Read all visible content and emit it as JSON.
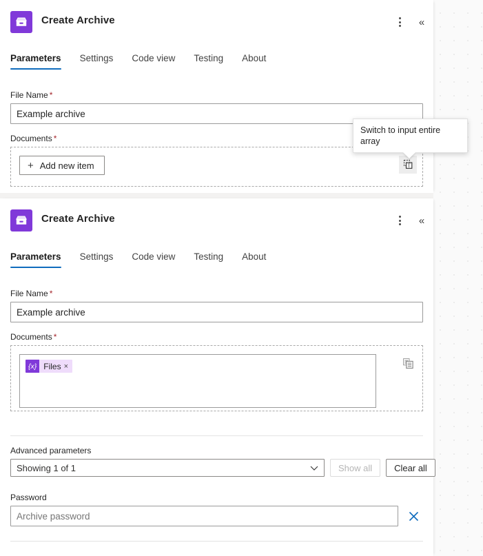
{
  "canvas": {
    "background_color": "#fafafa",
    "dot_color": "#c8c8c8"
  },
  "theme": {
    "brand_purple": "#8039d9",
    "accent_blue": "#0f6cbd",
    "required_red": "#a4262c",
    "token_bg": "#efdcfb"
  },
  "cards": [
    {
      "title": "Create Archive",
      "icon": "archive-box-icon",
      "menu_icon": "more-vertical-icon",
      "collapse_icon": "double-chevron-left-icon",
      "tabs": [
        {
          "label": "Parameters",
          "active": true
        },
        {
          "label": "Settings",
          "active": false
        },
        {
          "label": "Code view",
          "active": false
        },
        {
          "label": "Testing",
          "active": false
        },
        {
          "label": "About",
          "active": false
        }
      ],
      "file_name": {
        "label": "File Name",
        "required": "*",
        "value": "Example archive"
      },
      "documents": {
        "label": "Documents",
        "required": "*",
        "add_button": "Add new item",
        "add_icon": "plus-icon",
        "switch_icon": "switch-to-array-icon"
      }
    },
    {
      "title": "Create Archive",
      "icon": "archive-box-icon",
      "menu_icon": "more-vertical-icon",
      "collapse_icon": "double-chevron-left-icon",
      "tabs": [
        {
          "label": "Parameters",
          "active": true
        },
        {
          "label": "Settings",
          "active": false
        },
        {
          "label": "Code view",
          "active": false
        },
        {
          "label": "Testing",
          "active": false
        },
        {
          "label": "About",
          "active": false
        }
      ],
      "file_name": {
        "label": "File Name",
        "required": "*",
        "value": "Example archive"
      },
      "documents": {
        "label": "Documents",
        "required": "*",
        "switch_icon": "switch-to-array-icon",
        "token": {
          "badge": "{x}",
          "text": "Files",
          "remove": "×"
        }
      },
      "advanced": {
        "label": "Advanced parameters",
        "select_value": "Showing 1 of 1",
        "caret_icon": "chevron-down-icon",
        "show_all": "Show all",
        "show_all_disabled": true,
        "clear_all": "Clear all"
      },
      "password": {
        "label": "Password",
        "placeholder": "Archive password",
        "value": "",
        "clear_icon": "close-x-icon"
      }
    }
  ],
  "tooltip": {
    "text": "Switch to input entire array"
  }
}
